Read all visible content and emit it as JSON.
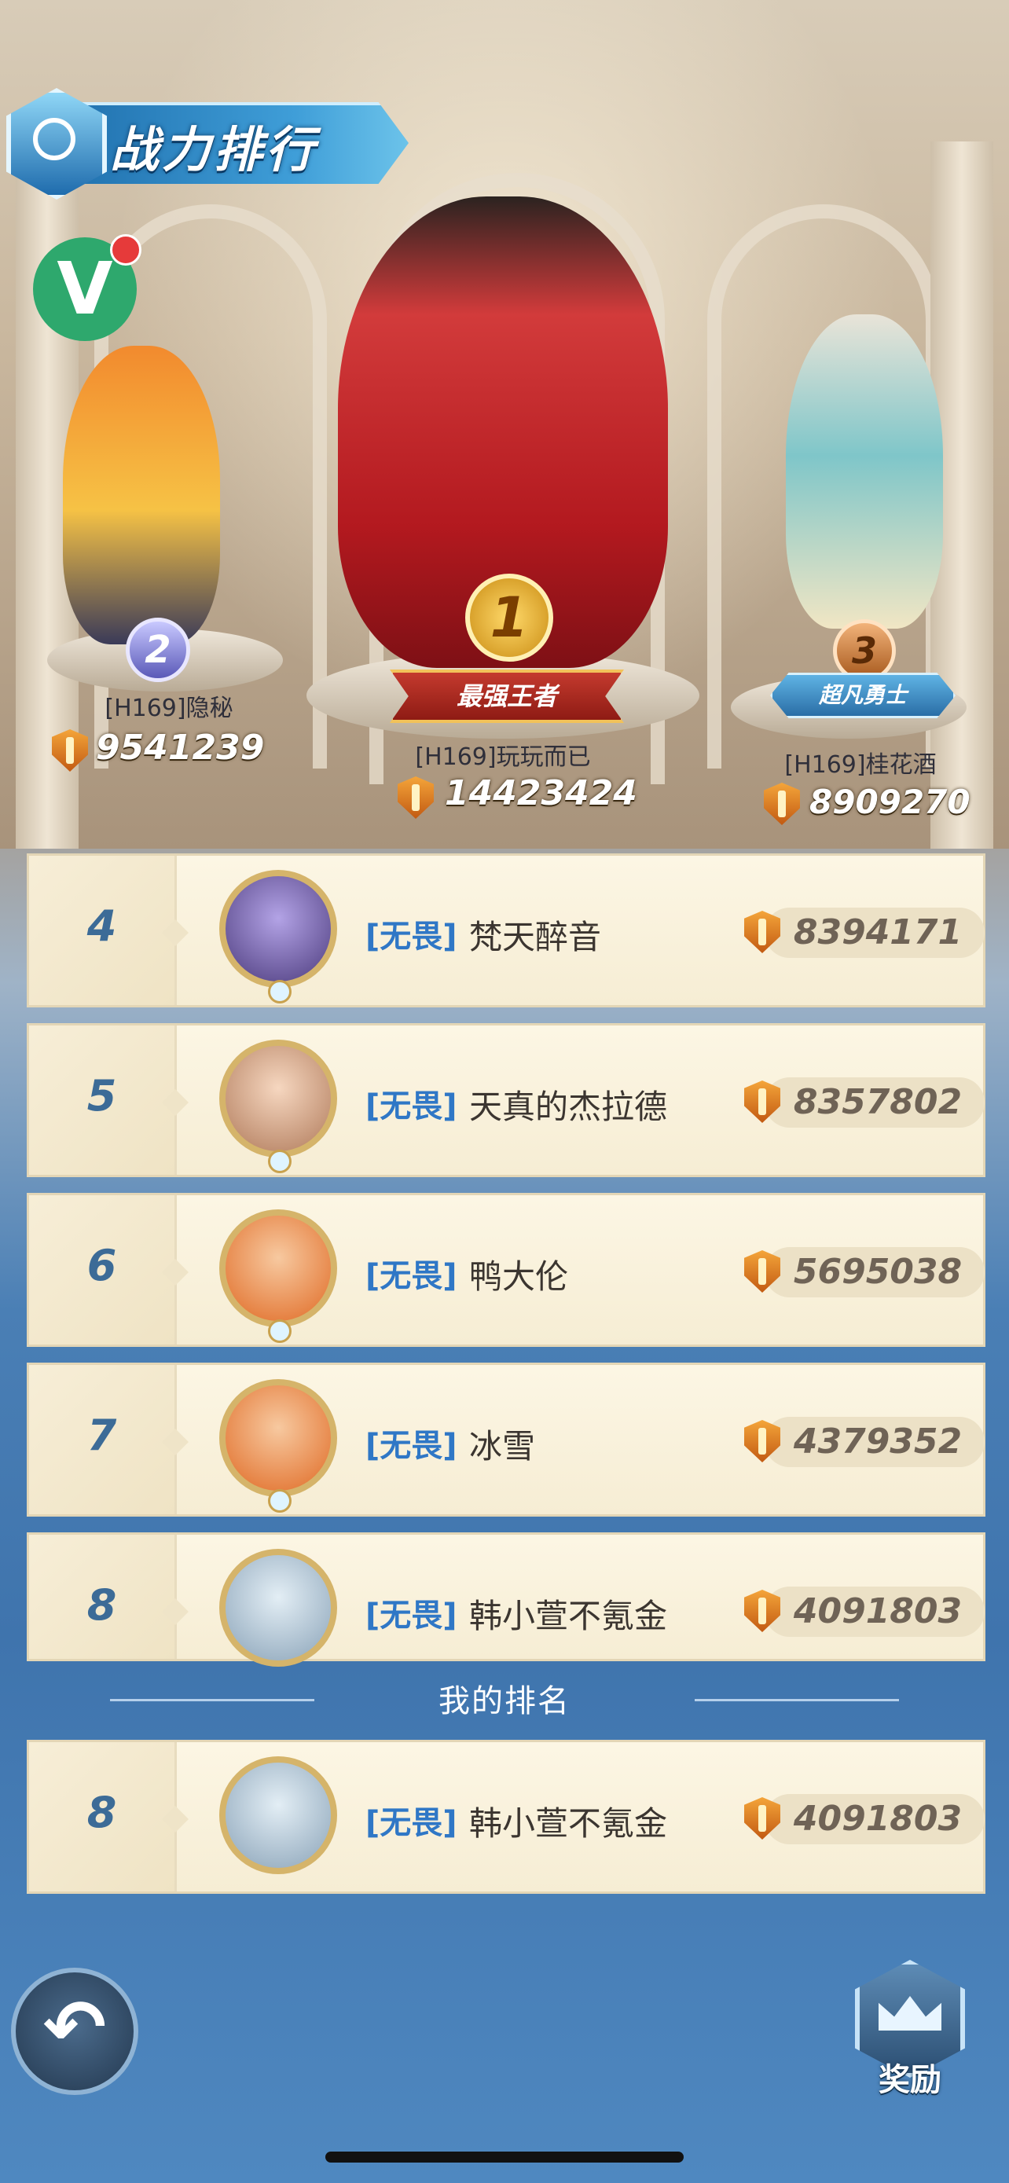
{
  "header": {
    "title": "战力排行"
  },
  "podium": [
    {
      "rank": "2",
      "name": "[H169]隐秘",
      "power": "9541239",
      "ribbon": ""
    },
    {
      "rank": "1",
      "name": "[H169]玩玩而已",
      "power": "14423424",
      "ribbon": "最强王者"
    },
    {
      "rank": "3",
      "name": "[H169]桂花酒",
      "power": "8909270",
      "ribbon": "超凡勇士"
    }
  ],
  "ranking": [
    {
      "rank": "4",
      "guild": "[无畏]",
      "name": "梵天醉音",
      "power": "8394171"
    },
    {
      "rank": "5",
      "guild": "[无畏]",
      "name": "天真的杰拉德",
      "power": "8357802"
    },
    {
      "rank": "6",
      "guild": "[无畏]",
      "name": "鸭大伦",
      "power": "5695038"
    },
    {
      "rank": "7",
      "guild": "[无畏]",
      "name": "冰雪",
      "power": "4379352"
    },
    {
      "rank": "8",
      "guild": "[无畏]",
      "name": "韩小萱不氪金",
      "power": "4091803"
    }
  ],
  "my_rank": {
    "section_label": "我的排名",
    "rank": "8",
    "guild": "[无畏]",
    "name": "韩小萱不氪金",
    "power": "4091803"
  },
  "buttons": {
    "reward_label": "奖励",
    "back_icon": "undo-arrow-icon"
  },
  "colors": {
    "rank_number": "#3c6b97",
    "guild_tag": "#2f77c6",
    "power_text": "#6f6356"
  }
}
